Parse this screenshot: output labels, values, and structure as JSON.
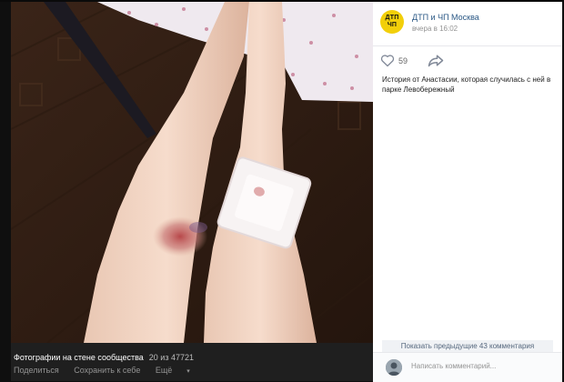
{
  "group": {
    "name": "ДТП и ЧП Москва",
    "time": "вчера в 16:02",
    "logo_lines": [
      "ДТП",
      "ЧП"
    ]
  },
  "post": {
    "likes": "59",
    "text": "История от Анастасии, которая случилась с ней в парке Левобережный"
  },
  "photo_footer": {
    "album_title": "Фотографии на стене сообщества",
    "album_count": "20 из 47721",
    "share_label": "Поделиться",
    "save_label": "Сохранить к себе",
    "more_label": "Ещё"
  },
  "comments": {
    "show_previous_label": "Показать предыдущие 43 комментария",
    "input_placeholder": "Написать комментарий..."
  },
  "colors": {
    "link": "#2a5885",
    "logo_bg": "#f2cf0a",
    "viewer_bg": "#0f0f0f"
  }
}
